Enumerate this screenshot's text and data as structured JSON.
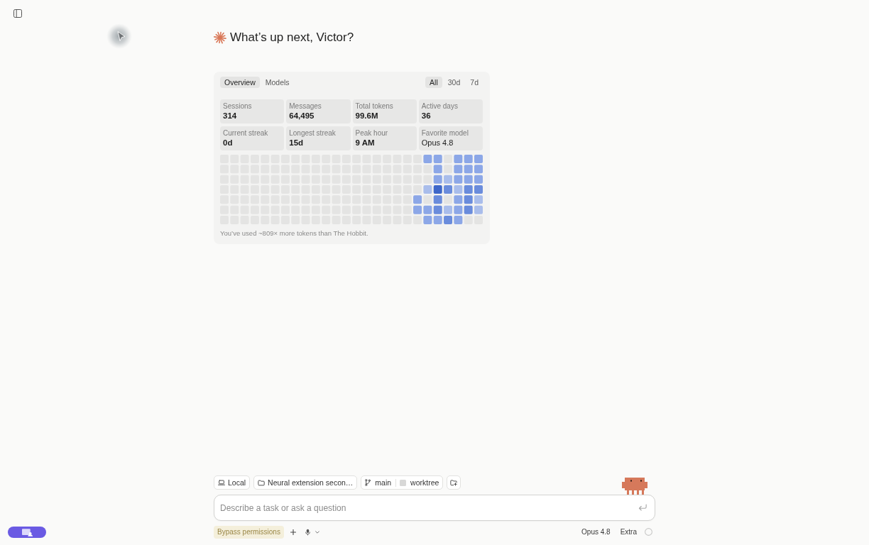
{
  "greeting": "What’s up next, Victor?",
  "stats_card": {
    "tabs": [
      {
        "label": "Overview",
        "selected": true
      },
      {
        "label": "Models",
        "selected": false
      }
    ],
    "ranges": [
      {
        "label": "All",
        "selected": true
      },
      {
        "label": "30d",
        "selected": false
      },
      {
        "label": "7d",
        "selected": false
      }
    ],
    "stats": [
      {
        "label": "Sessions",
        "value": "314",
        "kind": "metric"
      },
      {
        "label": "Messages",
        "value": "64,495",
        "kind": "metric"
      },
      {
        "label": "Total tokens",
        "value": "99.6M",
        "kind": "metric"
      },
      {
        "label": "Active days",
        "value": "36",
        "kind": "metric"
      },
      {
        "label": "Current streak",
        "value": "0d",
        "kind": "metric"
      },
      {
        "label": "Longest streak",
        "value": "15d",
        "kind": "metric"
      },
      {
        "label": "Peak hour",
        "value": "9 AM",
        "kind": "metric"
      },
      {
        "label": "Favorite model",
        "value": "Opus 4.8",
        "kind": "name"
      }
    ],
    "footnote": "You’ve used ~809× more tokens than The Hobbit."
  },
  "composer": {
    "context_chips": [
      {
        "kind": "environment",
        "label": "Local"
      },
      {
        "kind": "folder",
        "label": "Neural extension secon…"
      },
      {
        "kind": "branch",
        "label": "main",
        "worktree": {
          "label": "worktree",
          "checked": false
        }
      }
    ],
    "input": {
      "placeholder": "Describe a task or ask a question"
    },
    "permission_mode": "Bypass permissions",
    "model": "Opus 4.8",
    "effort": "Extra"
  }
}
